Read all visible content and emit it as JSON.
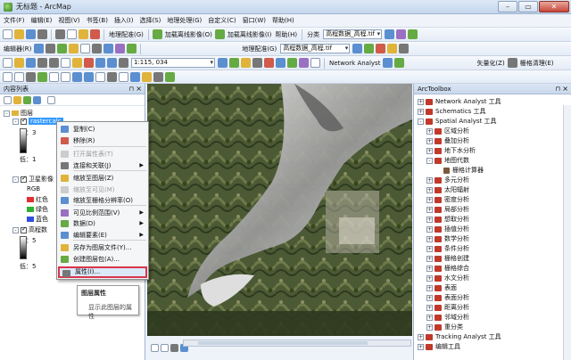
{
  "window": {
    "title": "无标题 - ArcMap"
  },
  "menus": [
    "文件(F)",
    "编辑(E)",
    "视图(V)",
    "书签(B)",
    "插入(I)",
    "选择(S)",
    "地理处理(G)",
    "自定义(C)",
    "窗口(W)",
    "帮助(H)"
  ],
  "toolbars": {
    "row1": {
      "georef_label": "地理配准(G)",
      "offline_label": "加载离线影像(O)",
      "online_label": "加载离线影像(I)",
      "help_label": "帮助(H)",
      "classify_label": "分类",
      "classify_layer": "高程数据_高程.tif"
    },
    "row2": {
      "edit_label": "编辑器(R)",
      "georef2_label": "地理配准(G)",
      "georef_layer": "高程数据_高程.tif"
    },
    "row3": {
      "scale": "1:115, 034",
      "network_label": "Network Analyst",
      "vector_label": "矢量化(Z)",
      "raster_clean_label": "栅格清理(E)"
    }
  },
  "toc": {
    "title": "内容列表",
    "root": "图层",
    "layer1": {
      "name": "rastercalc",
      "high": "高：3",
      "low": "低：1"
    },
    "layer2": {
      "name": "卫星影像",
      "rgb": "RGB",
      "red": "红色",
      "green": "绿色",
      "blue": "蓝色"
    },
    "layer3": {
      "name": "高程数",
      "high": "高：5",
      "low": "低：5"
    }
  },
  "context_menu": {
    "items": [
      {
        "label": "复制(C)",
        "disabled": false,
        "submenu": false
      },
      {
        "label": "移除(R)",
        "disabled": false,
        "submenu": false
      },
      {
        "label": "打开属性表(T)",
        "disabled": true,
        "submenu": false
      },
      {
        "label": "连接和关联(J)",
        "disabled": false,
        "submenu": true
      },
      {
        "label": "缩放至图层(Z)",
        "disabled": false,
        "submenu": false
      },
      {
        "label": "缩放至可见(M)",
        "disabled": true,
        "submenu": false
      },
      {
        "label": "缩放至栅格分辨率(O)",
        "disabled": false,
        "submenu": false
      },
      {
        "label": "可见比例范围(V)",
        "disabled": false,
        "submenu": true
      },
      {
        "label": "数据(D)",
        "disabled": false,
        "submenu": true
      },
      {
        "label": "编辑要素(E)",
        "disabled": false,
        "submenu": true
      },
      {
        "label": "另存为图层文件(Y)...",
        "disabled": false,
        "submenu": false
      },
      {
        "label": "创建图层包(A)...",
        "disabled": false,
        "submenu": false
      },
      {
        "label": "属性(I)...",
        "disabled": false,
        "submenu": false
      }
    ]
  },
  "tooltip": {
    "title": "图层属性",
    "body": "显示此图层的属性"
  },
  "toolbox": {
    "title": "ArcToolbox",
    "items": [
      {
        "label": "Network Analyst 工具",
        "level": 0,
        "expand": "+",
        "kind": "box"
      },
      {
        "label": "Schematics 工具",
        "level": 0,
        "expand": "+",
        "kind": "box"
      },
      {
        "label": "Spatial Analyst 工具",
        "level": 0,
        "expand": "-",
        "kind": "box"
      },
      {
        "label": "区域分析",
        "level": 1,
        "expand": "+",
        "kind": "box"
      },
      {
        "label": "叠加分析",
        "level": 1,
        "expand": "+",
        "kind": "box"
      },
      {
        "label": "地下水分析",
        "level": 1,
        "expand": "+",
        "kind": "box"
      },
      {
        "label": "地图代数",
        "level": 1,
        "expand": "-",
        "kind": "box"
      },
      {
        "label": "栅格计算器",
        "level": 2,
        "expand": "",
        "kind": "tool"
      },
      {
        "label": "多元分析",
        "level": 1,
        "expand": "+",
        "kind": "box"
      },
      {
        "label": "太阳辐射",
        "level": 1,
        "expand": "+",
        "kind": "box"
      },
      {
        "label": "密度分析",
        "level": 1,
        "expand": "+",
        "kind": "box"
      },
      {
        "label": "局部分析",
        "level": 1,
        "expand": "+",
        "kind": "box"
      },
      {
        "label": "想取分析",
        "level": 1,
        "expand": "+",
        "kind": "box"
      },
      {
        "label": "插值分析",
        "level": 1,
        "expand": "+",
        "kind": "box"
      },
      {
        "label": "数学分析",
        "level": 1,
        "expand": "+",
        "kind": "box"
      },
      {
        "label": "条件分析",
        "level": 1,
        "expand": "+",
        "kind": "box"
      },
      {
        "label": "栅格创建",
        "level": 1,
        "expand": "+",
        "kind": "box"
      },
      {
        "label": "栅格综合",
        "level": 1,
        "expand": "+",
        "kind": "box"
      },
      {
        "label": "水文分析",
        "level": 1,
        "expand": "+",
        "kind": "box"
      },
      {
        "label": "表面",
        "level": 1,
        "expand": "+",
        "kind": "box"
      },
      {
        "label": "表面分析",
        "level": 1,
        "expand": "+",
        "kind": "box"
      },
      {
        "label": "距离分析",
        "level": 1,
        "expand": "+",
        "kind": "box"
      },
      {
        "label": "邻域分析",
        "level": 1,
        "expand": "+",
        "kind": "box"
      },
      {
        "label": "重分类",
        "level": 1,
        "expand": "+",
        "kind": "box"
      },
      {
        "label": "Tracking Analyst 工具",
        "level": 0,
        "expand": "+",
        "kind": "box"
      },
      {
        "label": "编辑工具",
        "level": 0,
        "expand": "+",
        "kind": "box"
      }
    ]
  },
  "colors": {
    "highlight_border": "#d9344a",
    "toolbox_icon": "#c0392b",
    "selection": "#3399ff"
  }
}
